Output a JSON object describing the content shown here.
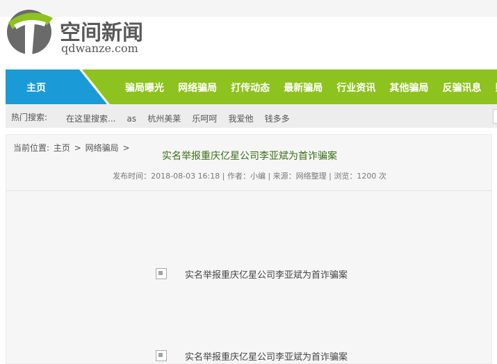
{
  "logo": {
    "cn": "空间新闻",
    "en": "qdwanze.com"
  },
  "nav": {
    "home": "主页",
    "items": [
      "骗局曝光",
      "网络骗局",
      "打传动态",
      "最新骗局",
      "行业资讯",
      "其他骗局",
      "反骗讯息",
      "财"
    ],
    "colors": {
      "green": "#8dc21f",
      "blue": "#1a9bd7"
    }
  },
  "hot": {
    "label": "热门搜索:",
    "items": [
      "在这里搜索...",
      "as",
      "杭州美莱",
      "乐呵呵",
      "我爱他",
      "钱多多"
    ]
  },
  "breadcrumb": {
    "label": "当前位置:",
    "home": "主页",
    "sep1": ">",
    "section": "网络骗局",
    "sep2": ">"
  },
  "article": {
    "title": "实名举报重庆亿星公司李亚斌为首诈骗案",
    "meta": "发布时间：2018-08-03 16:18 | 作者：小编 | 来源：网络整理 | 浏览：1200 次",
    "images": [
      {
        "alt": "实名举报重庆亿星公司李亚斌为首诈骗案"
      },
      {
        "alt": "实名举报重庆亿星公司李亚斌为首诈骗案"
      }
    ]
  }
}
